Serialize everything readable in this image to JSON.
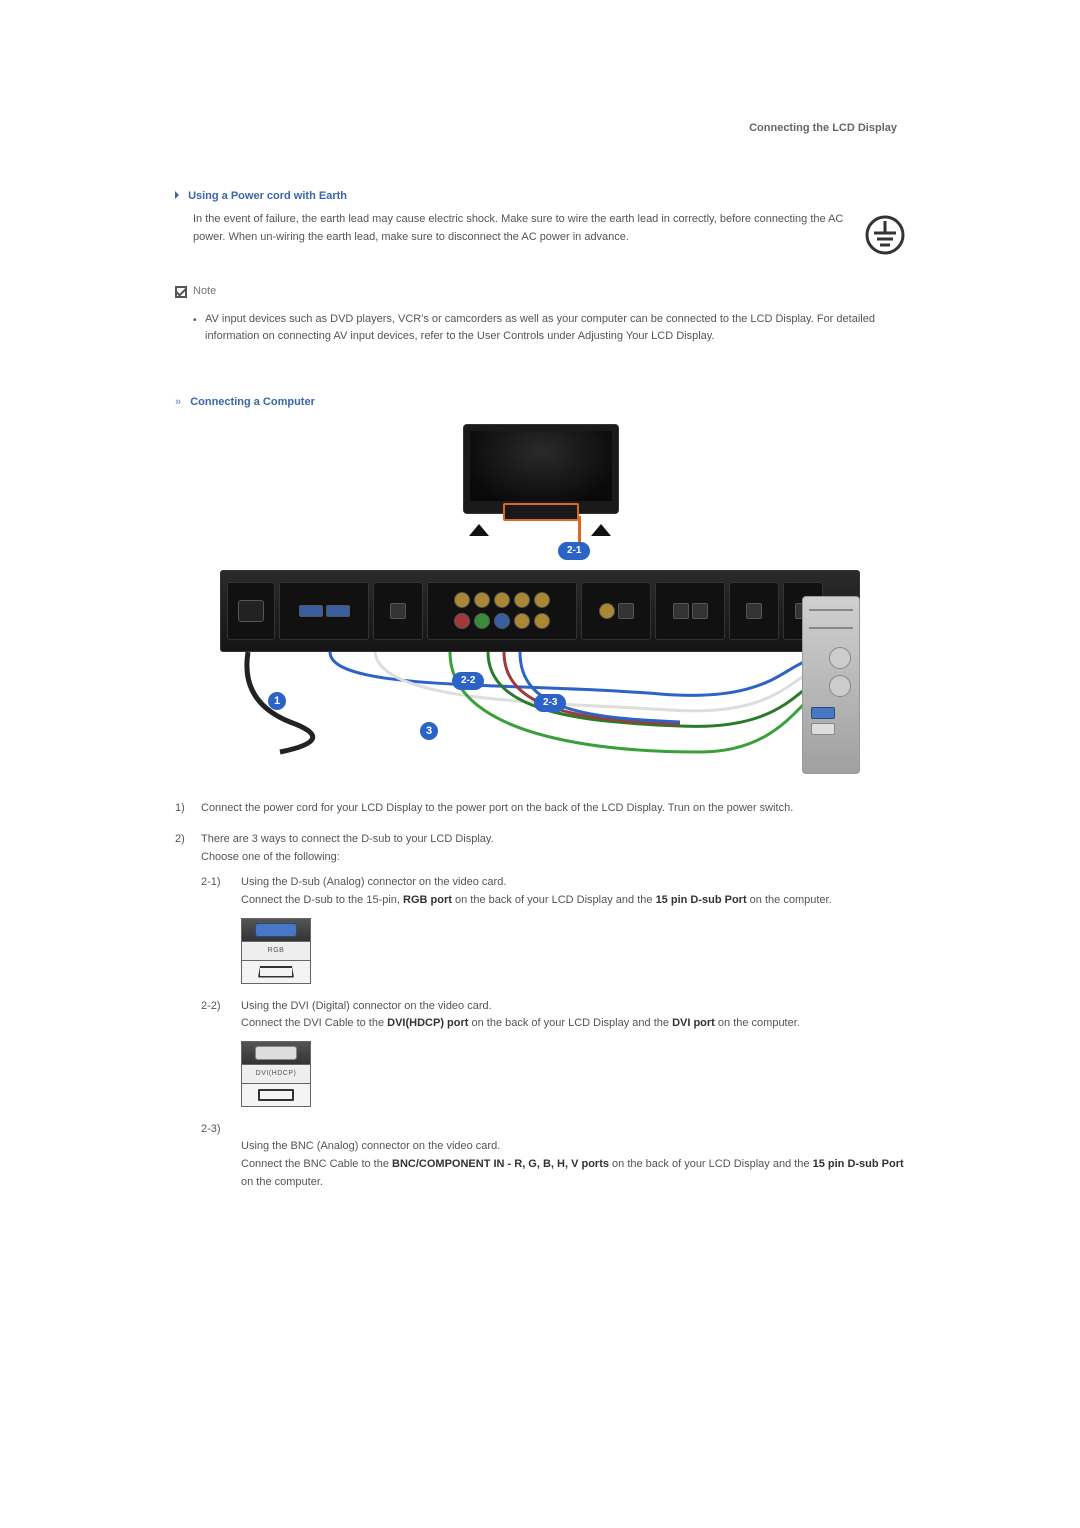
{
  "header": {
    "title": "Connecting the LCD Display"
  },
  "section1": {
    "heading": "Using a Power cord with Earth",
    "text": "In the event of failure, the earth lead may cause electric shock. Make sure to wire the earth lead in correctly, before connecting the AC power. When un-wiring the earth lead, make sure to disconnect the AC power in advance.",
    "earth_icon": "earth-ground-icon"
  },
  "note": {
    "label": "Note",
    "items": [
      "AV input devices such as DVD players, VCR's or camcorders as well as your computer can be connected to the LCD Display. For detailed information on connecting AV input devices, refer to the User Controls under Adjusting Your LCD Display."
    ]
  },
  "section2": {
    "heading": "Connecting a Computer",
    "diagram": {
      "callouts": {
        "top": "2-1",
        "mid": "2-2",
        "low": "2-3",
        "left_circle": "1",
        "bottom_circle": "3"
      }
    }
  },
  "steps": {
    "step1": {
      "num": "1)",
      "text": "Connect the power cord for your LCD Display to the power port on the back of the LCD Display. Trun on the power switch."
    },
    "step2": {
      "num": "2)",
      "intro1": "There are 3 ways to connect the D-sub to your LCD Display.",
      "intro2": "Choose one of the following:",
      "sub": {
        "s1": {
          "num": "2-1)",
          "line1": "Using the D-sub (Analog) connector on the video card.",
          "line2a": "Connect the D-sub to the 15-pin, ",
          "bold2a": "RGB port",
          "line2b": " on the back of your LCD Display and the ",
          "bold2b": "15 pin D-sub Port",
          "line2c": " on the computer.",
          "fig_label": "RGB"
        },
        "s2": {
          "num": "2-2)",
          "line1": "Using the DVI (Digital) connector on the video card.",
          "line2a": "Connect the DVI Cable to the ",
          "bold2a": "DVI(HDCP) port",
          "line2b": " on the back of your LCD Display and the ",
          "bold2b": "DVI port",
          "line2c": " on the computer.",
          "fig_label": "DVI(HDCP)"
        },
        "s3": {
          "num": "2-3)",
          "line1": "Using the BNC (Analog) connector on the video card.",
          "line2a": "Connect the BNC Cable to the ",
          "bold2a": "BNC/COMPONENT IN - R, G, B, H, V ports",
          "line2b": " on the back of your LCD Display and the ",
          "bold2b": "15 pin D-sub Port",
          "line2c": " on the computer."
        }
      }
    }
  }
}
